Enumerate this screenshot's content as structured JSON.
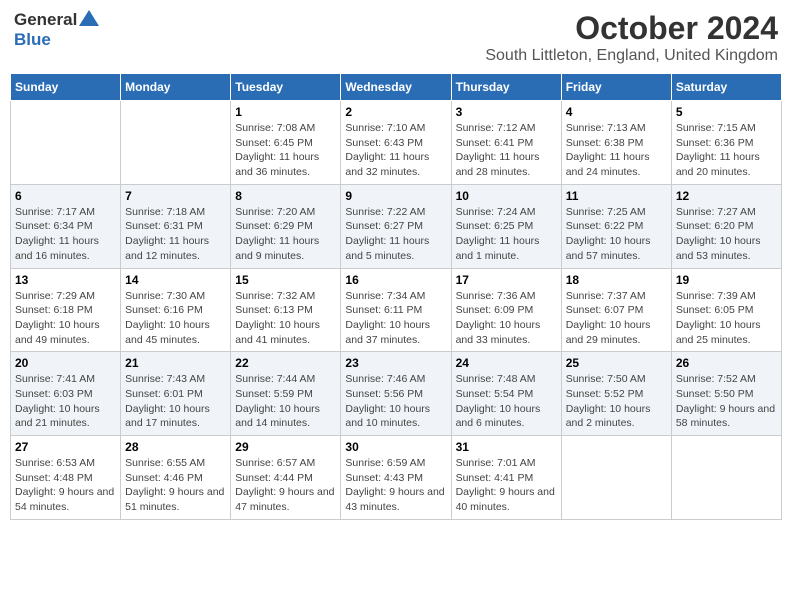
{
  "header": {
    "logo_general": "General",
    "logo_blue": "Blue",
    "month_title": "October 2024",
    "location": "South Littleton, England, United Kingdom"
  },
  "days_of_week": [
    "Sunday",
    "Monday",
    "Tuesday",
    "Wednesday",
    "Thursday",
    "Friday",
    "Saturday"
  ],
  "weeks": [
    [
      {
        "day": "",
        "info": ""
      },
      {
        "day": "",
        "info": ""
      },
      {
        "day": "1",
        "info": "Sunrise: 7:08 AM\nSunset: 6:45 PM\nDaylight: 11 hours and 36 minutes."
      },
      {
        "day": "2",
        "info": "Sunrise: 7:10 AM\nSunset: 6:43 PM\nDaylight: 11 hours and 32 minutes."
      },
      {
        "day": "3",
        "info": "Sunrise: 7:12 AM\nSunset: 6:41 PM\nDaylight: 11 hours and 28 minutes."
      },
      {
        "day": "4",
        "info": "Sunrise: 7:13 AM\nSunset: 6:38 PM\nDaylight: 11 hours and 24 minutes."
      },
      {
        "day": "5",
        "info": "Sunrise: 7:15 AM\nSunset: 6:36 PM\nDaylight: 11 hours and 20 minutes."
      }
    ],
    [
      {
        "day": "6",
        "info": "Sunrise: 7:17 AM\nSunset: 6:34 PM\nDaylight: 11 hours and 16 minutes."
      },
      {
        "day": "7",
        "info": "Sunrise: 7:18 AM\nSunset: 6:31 PM\nDaylight: 11 hours and 12 minutes."
      },
      {
        "day": "8",
        "info": "Sunrise: 7:20 AM\nSunset: 6:29 PM\nDaylight: 11 hours and 9 minutes."
      },
      {
        "day": "9",
        "info": "Sunrise: 7:22 AM\nSunset: 6:27 PM\nDaylight: 11 hours and 5 minutes."
      },
      {
        "day": "10",
        "info": "Sunrise: 7:24 AM\nSunset: 6:25 PM\nDaylight: 11 hours and 1 minute."
      },
      {
        "day": "11",
        "info": "Sunrise: 7:25 AM\nSunset: 6:22 PM\nDaylight: 10 hours and 57 minutes."
      },
      {
        "day": "12",
        "info": "Sunrise: 7:27 AM\nSunset: 6:20 PM\nDaylight: 10 hours and 53 minutes."
      }
    ],
    [
      {
        "day": "13",
        "info": "Sunrise: 7:29 AM\nSunset: 6:18 PM\nDaylight: 10 hours and 49 minutes."
      },
      {
        "day": "14",
        "info": "Sunrise: 7:30 AM\nSunset: 6:16 PM\nDaylight: 10 hours and 45 minutes."
      },
      {
        "day": "15",
        "info": "Sunrise: 7:32 AM\nSunset: 6:13 PM\nDaylight: 10 hours and 41 minutes."
      },
      {
        "day": "16",
        "info": "Sunrise: 7:34 AM\nSunset: 6:11 PM\nDaylight: 10 hours and 37 minutes."
      },
      {
        "day": "17",
        "info": "Sunrise: 7:36 AM\nSunset: 6:09 PM\nDaylight: 10 hours and 33 minutes."
      },
      {
        "day": "18",
        "info": "Sunrise: 7:37 AM\nSunset: 6:07 PM\nDaylight: 10 hours and 29 minutes."
      },
      {
        "day": "19",
        "info": "Sunrise: 7:39 AM\nSunset: 6:05 PM\nDaylight: 10 hours and 25 minutes."
      }
    ],
    [
      {
        "day": "20",
        "info": "Sunrise: 7:41 AM\nSunset: 6:03 PM\nDaylight: 10 hours and 21 minutes."
      },
      {
        "day": "21",
        "info": "Sunrise: 7:43 AM\nSunset: 6:01 PM\nDaylight: 10 hours and 17 minutes."
      },
      {
        "day": "22",
        "info": "Sunrise: 7:44 AM\nSunset: 5:59 PM\nDaylight: 10 hours and 14 minutes."
      },
      {
        "day": "23",
        "info": "Sunrise: 7:46 AM\nSunset: 5:56 PM\nDaylight: 10 hours and 10 minutes."
      },
      {
        "day": "24",
        "info": "Sunrise: 7:48 AM\nSunset: 5:54 PM\nDaylight: 10 hours and 6 minutes."
      },
      {
        "day": "25",
        "info": "Sunrise: 7:50 AM\nSunset: 5:52 PM\nDaylight: 10 hours and 2 minutes."
      },
      {
        "day": "26",
        "info": "Sunrise: 7:52 AM\nSunset: 5:50 PM\nDaylight: 9 hours and 58 minutes."
      }
    ],
    [
      {
        "day": "27",
        "info": "Sunrise: 6:53 AM\nSunset: 4:48 PM\nDaylight: 9 hours and 54 minutes."
      },
      {
        "day": "28",
        "info": "Sunrise: 6:55 AM\nSunset: 4:46 PM\nDaylight: 9 hours and 51 minutes."
      },
      {
        "day": "29",
        "info": "Sunrise: 6:57 AM\nSunset: 4:44 PM\nDaylight: 9 hours and 47 minutes."
      },
      {
        "day": "30",
        "info": "Sunrise: 6:59 AM\nSunset: 4:43 PM\nDaylight: 9 hours and 43 minutes."
      },
      {
        "day": "31",
        "info": "Sunrise: 7:01 AM\nSunset: 4:41 PM\nDaylight: 9 hours and 40 minutes."
      },
      {
        "day": "",
        "info": ""
      },
      {
        "day": "",
        "info": ""
      }
    ]
  ]
}
